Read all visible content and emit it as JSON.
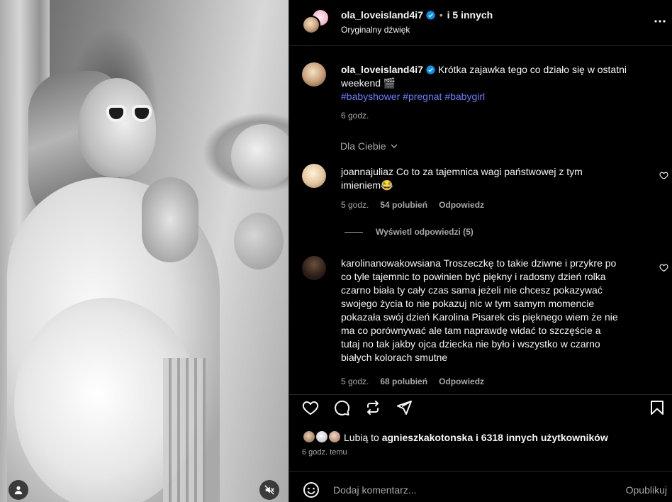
{
  "header": {
    "username": "ola_loveisland4i7",
    "collaborators": "i 5 innych",
    "audio": "Oryginalny dźwięk"
  },
  "caption": {
    "username": "ola_loveisland4i7",
    "text_line1": "Krótka zajawka tego co działo się w ostatni",
    "text_line2": "weekend 🎬",
    "hashtags": "#babyshower #pregnat #babygirl",
    "time": "6 godz."
  },
  "section_label": "Dla Ciebie",
  "comments": [
    {
      "username": "joannajuliaz",
      "text_first": "Co to za tajemnica wagi państwowej z tym",
      "text_rest": "imieniem😂",
      "time": "5 godz.",
      "likes": "54 polubień",
      "reply": "Odpowiedz",
      "view_replies": "Wyświetl odpowiedzi (5)"
    },
    {
      "username": "karolinanowakowsiana",
      "text_first": "Troszeczkę to takie dziwne i przykre po",
      "lines": [
        "co tyle tajemnic to powinien być piękny i radosny dzień rolka",
        "czarno biała ty cały czas sama jeżeli nie chcesz pokazywać",
        "swojego życia to nie pokazuj nic w tym samym momencie",
        "pokazała swój dzień Karolina Pisarek cis pięknego wiem że nie",
        "ma co porównywać ale tam naprawdę widać to szczęście a",
        "tutaj no tak jakby ojca dziecka nie było i wszystko w czarno",
        "białych kolorach smutne"
      ],
      "time": "5 godz.",
      "likes": "68 polubień",
      "reply": "Odpowiedz"
    }
  ],
  "likes": {
    "prefix": "Lubią to",
    "user": "agnieszkakotonska",
    "suffix": "i 6318 innych użytkowników",
    "time": "6 godz. temu"
  },
  "composer": {
    "placeholder": "Dodaj komentarz...",
    "publish": "Opublikuj"
  },
  "icons": [
    "user-tag-icon",
    "muted-speaker-icon",
    "more-options-icon",
    "verified-badge-icon",
    "chevron-down-icon",
    "heart-icon",
    "comment-icon",
    "repost-icon",
    "share-icon",
    "bookmark-icon",
    "emoji-icon"
  ],
  "colors": {
    "background": "#000000",
    "text": "#f5f5f5",
    "muted": "#a8a8a8",
    "hashtag": "#6a7dff",
    "verified": "#0095f6",
    "divider": "#262626"
  }
}
